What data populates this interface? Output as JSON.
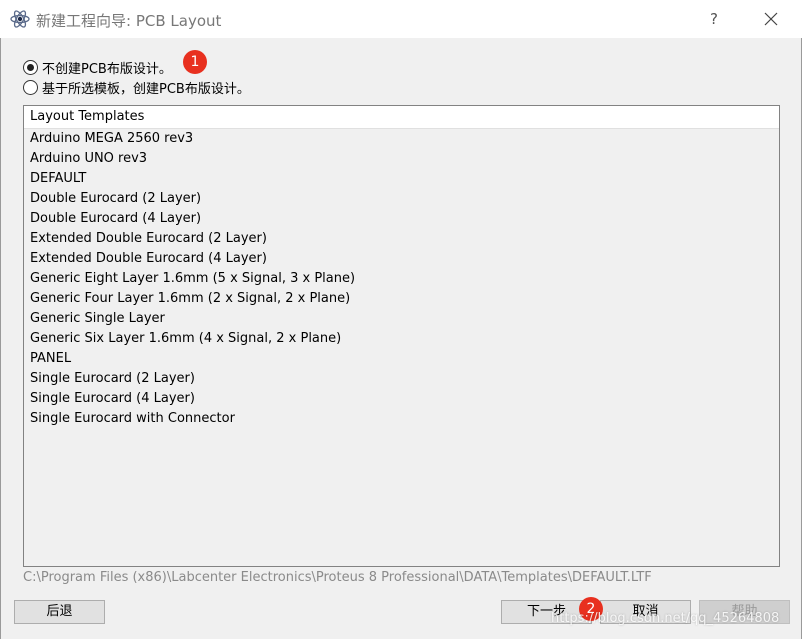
{
  "window": {
    "title": "新建工程向导: PCB Layout",
    "help_label": "?",
    "icon": "atom-icon",
    "close_icon": "close-icon"
  },
  "options": {
    "no_pcb": {
      "label": "不创建PCB布版设计。",
      "checked": true
    },
    "from_template": {
      "label": "基于所选模板，创建PCB布版设计。",
      "checked": false
    }
  },
  "annotations": {
    "badge1": "1",
    "badge2": "2"
  },
  "templates": {
    "header": "Layout Templates",
    "items": [
      "Arduino MEGA 2560 rev3",
      "Arduino UNO rev3",
      "DEFAULT",
      "Double Eurocard (2 Layer)",
      "Double Eurocard (4 Layer)",
      "Extended Double Eurocard (2 Layer)",
      "Extended Double Eurocard (4 Layer)",
      "Generic Eight Layer 1.6mm (5 x Signal, 3 x Plane)",
      "Generic Four Layer 1.6mm (2 x Signal, 2 x Plane)",
      "Generic Single Layer",
      "Generic Six Layer 1.6mm (4 x Signal, 2 x Plane)",
      "PANEL",
      "Single Eurocard (2 Layer)",
      "Single Eurocard (4 Layer)",
      "Single Eurocard with Connector"
    ]
  },
  "template_path": "C:\\Program Files (x86)\\Labcenter Electronics\\Proteus 8 Professional\\DATA\\Templates\\DEFAULT.LTF",
  "buttons": {
    "back": "后退",
    "next": "下一步",
    "cancel": "取消",
    "help": "帮助"
  },
  "watermark": "https://blog.csdn.net/qq_45264808",
  "colors": {
    "badge": "#e8301f"
  }
}
